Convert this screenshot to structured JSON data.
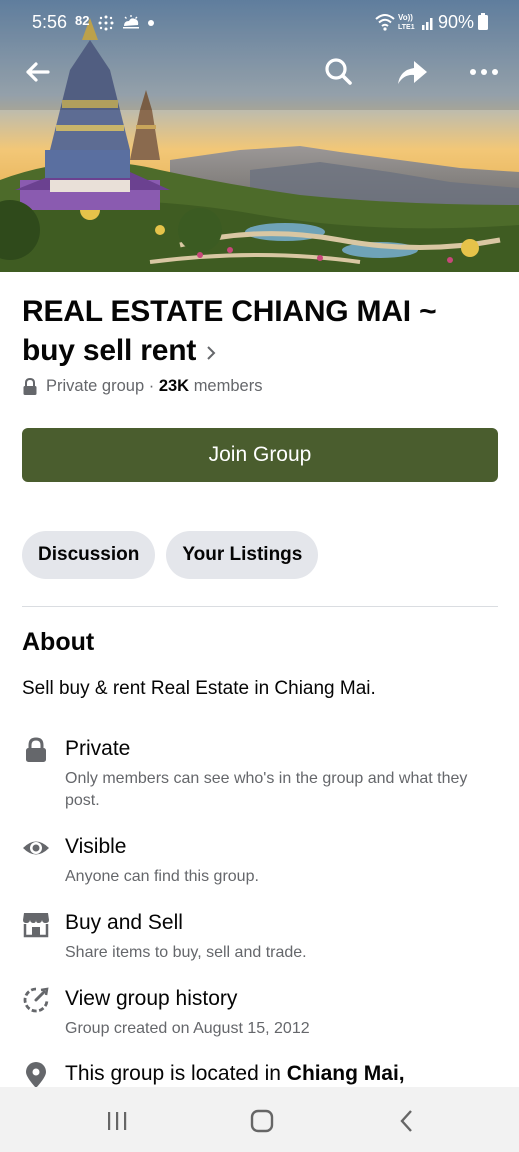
{
  "status_bar": {
    "time": "5:56",
    "notification_count": "82",
    "battery": "90%"
  },
  "header": {
    "title": "REAL ESTATE CHIANG MAI  ~ buy sell rent",
    "privacy": "Private group",
    "separator": " · ",
    "member_count": "23K",
    "members_label": "members"
  },
  "actions": {
    "join_label": "Join Group"
  },
  "tabs": [
    {
      "label": "Discussion"
    },
    {
      "label": "Your Listings"
    }
  ],
  "about": {
    "title": "About",
    "description": "Sell buy & rent Real Estate in Chiang Mai.",
    "items": [
      {
        "icon": "lock-icon",
        "title": "Private",
        "subtitle": "Only members can see who's in the group and what they post."
      },
      {
        "icon": "eye-icon",
        "title": "Visible",
        "subtitle": "Anyone can find this group."
      },
      {
        "icon": "store-icon",
        "title": "Buy and Sell",
        "subtitle": "Share items to buy, sell and trade."
      },
      {
        "icon": "history-icon",
        "title": "View group history",
        "subtitle": "Group created on August 15, 2012"
      },
      {
        "icon": "location-pin-icon",
        "title_prefix": "This group is located in ",
        "title_bold": "Chiang Mai,"
      }
    ]
  },
  "colors": {
    "join_button": "#4a5d2e",
    "tab_background": "#e4e6eb",
    "secondary_text": "#65676b"
  }
}
